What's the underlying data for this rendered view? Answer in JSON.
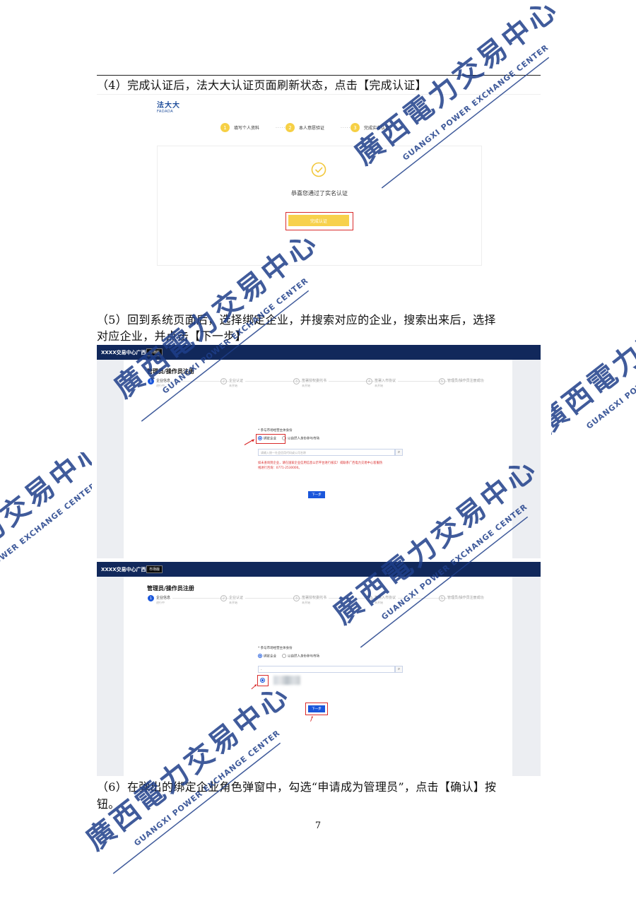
{
  "paragraphs": {
    "p4": "（4）完成认证后，法大大认证页面刷新状态，点击【完成认证】",
    "p5_line1": "（5）回到系统页面后，选择绑定企业，并搜索对应的企业，搜索出来后，选择",
    "p5_line2": "对应企业，并点击【下一步】",
    "p6_line1": "（6）在弹出的绑定企业角色弹窗中，勾选“申请成为管理员”，点击【确认】按",
    "p6_line2": "钮。"
  },
  "page_number": "7",
  "fadada": {
    "logo_cn": "法大大",
    "logo_en": "FADADA",
    "steps": [
      {
        "num": "1",
        "label": "填写个人资料"
      },
      {
        "num": "2",
        "label": "本人意愿验证"
      },
      {
        "num": "3",
        "label": "完成实名认证"
      }
    ],
    "step_separator": "······",
    "success_text": "恭喜您通过了实名认证",
    "done_button": "完成认证"
  },
  "system": {
    "brand": "XXXX交易中心广西",
    "brand_tag": "市场版",
    "register_title": "管理员/操作员注册",
    "steps": [
      {
        "num": "1",
        "label": "企业信息",
        "status": "进行中"
      },
      {
        "num": "2",
        "label": "企业认证",
        "status": "未开始"
      },
      {
        "num": "3",
        "label": "签署授权委托书",
        "status": "未开始"
      },
      {
        "num": "4",
        "label": "签署入市协议",
        "status": "未开始"
      },
      {
        "num": "5",
        "label": "管理员/操作员注册成功",
        "status": ""
      }
    ],
    "question": "* 参与市场经营主体身份",
    "option_bind": "绑定企业",
    "option_person": "以自然人身份参与市场",
    "search_placeholder": "请输入统一社会信用代码或公司名称",
    "search_icon": "search-icon",
    "warning": "如未查询到企业，请在国家企业信用信息公示平台进行核实！或联系广西电力交易中心客服热线进行咨询：0771-2530000。",
    "next_button": "下一步",
    "search_value2": "-"
  },
  "watermark": {
    "cn": "廣西電力交易中心",
    "en": "GUANGXI POWER EXCHANGE CENTER"
  },
  "colors": {
    "accent_blue": "#1a56db",
    "header_navy": "#11285b",
    "highlight_red": "#d92b2b",
    "fadada_yellow": "#f6d045",
    "watermark_blue": "#1f3f8a"
  }
}
